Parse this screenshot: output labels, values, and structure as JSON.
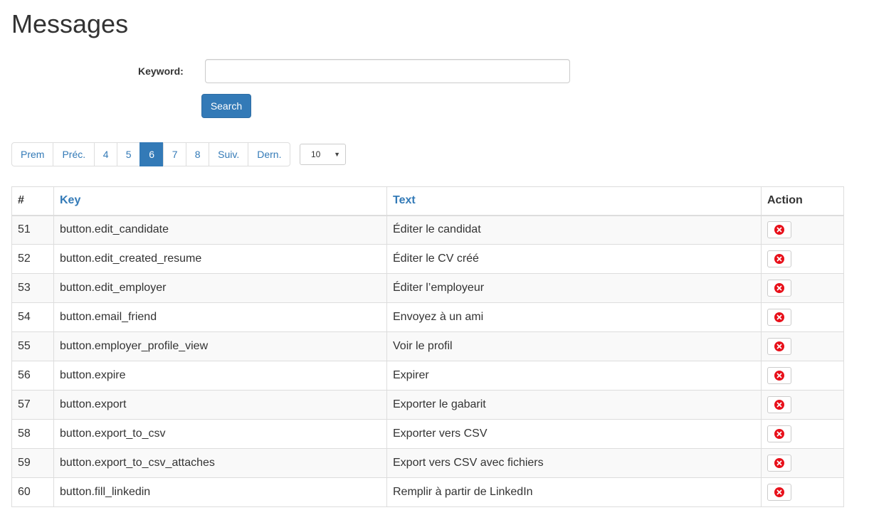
{
  "page": {
    "title": "Messages"
  },
  "search": {
    "keyword_label": "Keyword:",
    "keyword_value": "",
    "keyword_placeholder": "",
    "button_label": "Search"
  },
  "pagination": {
    "first": "Prem",
    "prev": "Préc.",
    "pages": [
      "4",
      "5",
      "6",
      "7",
      "8"
    ],
    "current": "6",
    "next": "Suiv.",
    "last": "Dern.",
    "page_size": "10"
  },
  "table": {
    "headers": {
      "num": "#",
      "key": "Key",
      "text": "Text",
      "action": "Action"
    },
    "rows": [
      {
        "num": "51",
        "key": "button.edit_candidate",
        "text": "Éditer le candidat"
      },
      {
        "num": "52",
        "key": "button.edit_created_resume",
        "text": "Éditer le CV créé"
      },
      {
        "num": "53",
        "key": "button.edit_employer",
        "text": "Éditer l’employeur"
      },
      {
        "num": "54",
        "key": "button.email_friend",
        "text": "Envoyez à un ami"
      },
      {
        "num": "55",
        "key": "button.employer_profile_view",
        "text": "Voir le profil"
      },
      {
        "num": "56",
        "key": "button.expire",
        "text": "Expirer"
      },
      {
        "num": "57",
        "key": "button.export",
        "text": "Exporter le gabarit"
      },
      {
        "num": "58",
        "key": "button.export_to_csv",
        "text": "Exporter vers CSV"
      },
      {
        "num": "59",
        "key": "button.export_to_csv_attaches",
        "text": "Export vers CSV avec fichiers"
      },
      {
        "num": "60",
        "key": "button.fill_linkedin",
        "text": "Remplir à partir de LinkedIn"
      }
    ]
  },
  "colors": {
    "accent": "#337ab7",
    "delete": "#e8101a"
  }
}
